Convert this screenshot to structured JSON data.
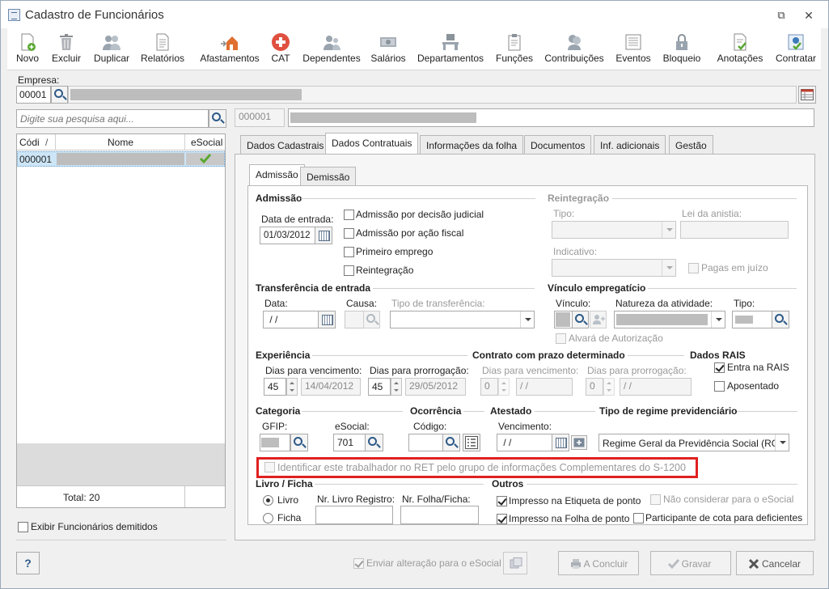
{
  "window": {
    "title": "Cadastro de Funcionários"
  },
  "toolbar": {
    "items": [
      {
        "label": "Novo",
        "icon": "new-doc-icon"
      },
      {
        "label": "Excluir",
        "icon": "trash-icon"
      },
      {
        "label": "Duplicar",
        "icon": "users-icon"
      },
      {
        "label": "Relatórios",
        "icon": "report-icon"
      },
      {
        "label": "Afastamentos",
        "icon": "house-arrow-icon"
      },
      {
        "label": "CAT",
        "icon": "red-cross-icon"
      },
      {
        "label": "Dependentes",
        "icon": "people-icon"
      },
      {
        "label": "Salários",
        "icon": "money-icon"
      },
      {
        "label": "Departamentos",
        "icon": "desk-icon"
      },
      {
        "label": "Funções",
        "icon": "clipboard-icon"
      },
      {
        "label": "Contribuições",
        "icon": "contribution-icon"
      },
      {
        "label": "Eventos",
        "icon": "list-icon"
      },
      {
        "label": "Bloqueio",
        "icon": "lock-icon"
      },
      {
        "label": "Anotações",
        "icon": "note-check-icon"
      },
      {
        "label": "Contratar",
        "icon": "hire-icon"
      }
    ]
  },
  "empresa": {
    "label": "Empresa:",
    "code": "00001"
  },
  "search": {
    "placeholder": "Digite sua pesquisa aqui..."
  },
  "employee_code": "000001",
  "grid": {
    "columns": [
      "Códi",
      "Nome",
      "eSocial"
    ],
    "rows": [
      {
        "code": "000001"
      }
    ],
    "total": "Total: 20"
  },
  "show_dismissed": "Exibir Funcionários demitidos",
  "tabs": [
    "Dados Cadastrais",
    "Dados Contratuais",
    "Informações da folha",
    "Documentos",
    "Inf. adicionais",
    "Gestão"
  ],
  "subtabs": [
    "Admissão",
    "Demissão"
  ],
  "admissao": {
    "header": "Admissão",
    "date_label": "Data de entrada:",
    "date": "01/03/2012",
    "checks": [
      "Admissão por decisão judicial",
      "Admissão por ação fiscal",
      "Primeiro emprego",
      "Reintegração"
    ]
  },
  "reintegracao": {
    "header": "Reintegração",
    "tipo": "Tipo:",
    "lei": "Lei da anistia:",
    "indicativo": "Indicativo:",
    "pagas": "Pagas em juízo"
  },
  "transferencia": {
    "header": "Transferência de entrada",
    "data": "Data:",
    "data_value": " / /",
    "causa": "Causa:",
    "tipo": "Tipo de transferência:"
  },
  "vinculo": {
    "header": "Vínculo empregatício",
    "vinculo": "Vínculo:",
    "natureza": "Natureza da atividade:",
    "tipo": "Tipo:",
    "alvara": "Alvará de Autorização"
  },
  "experiencia": {
    "header": "Experiência",
    "venc": "Dias para vencimento:",
    "prorr": "Dias para prorrogação:",
    "venc_days": "45",
    "venc_date": "14/04/2012",
    "prorr_days": "45",
    "prorr_date": "29/05/2012"
  },
  "contrato": {
    "header": "Contrato com prazo determinado",
    "venc": "Dias para vencimento:",
    "prorr": "Dias para prorrogação:",
    "venc_days": "0",
    "venc_date": " / /",
    "prorr_days": "0",
    "prorr_date": " / /"
  },
  "rais": {
    "header": "Dados RAIS",
    "entra": "Entra na RAIS",
    "aposentado": "Aposentado"
  },
  "categoria": {
    "header": "Categoria",
    "gfip": "GFIP:",
    "esocial": "eSocial:",
    "esocial_value": "701"
  },
  "ocorrencia": {
    "header": "Ocorrência",
    "codigo": "Código:"
  },
  "atestado": {
    "header": "Atestado",
    "vencimento": "Vencimento:",
    "value": " / /"
  },
  "regime": {
    "header": "Tipo de regime previdenciário",
    "value": "Regime Geral da Previdência Social (RGP"
  },
  "ret": "Identificar este trabalhador no RET pelo grupo de informações Complementares do S-1200",
  "livro": {
    "header": "Livro / Ficha",
    "livro": "Livro",
    "ficha": "Ficha",
    "nr_livro": "Nr. Livro Registro:",
    "nr_folha": "Nr. Folha/Ficha:"
  },
  "outros": {
    "header": "Outros",
    "etiqueta": "Impresso na Etiqueta de ponto",
    "folha": "Impresso na Folha de ponto",
    "nao_considerar": "Não considerar para o eSocial",
    "participante": "Participante de cota para deficientes"
  },
  "footer": {
    "help": "?",
    "enviar": "Enviar alteração para o eSocial",
    "concluir": "A Concluir",
    "gravar": "Gravar",
    "cancelar": "Cancelar"
  },
  "colors": {
    "accent": "#2d5a88",
    "highlight": "#e02020",
    "selection": "#cde6f7"
  }
}
